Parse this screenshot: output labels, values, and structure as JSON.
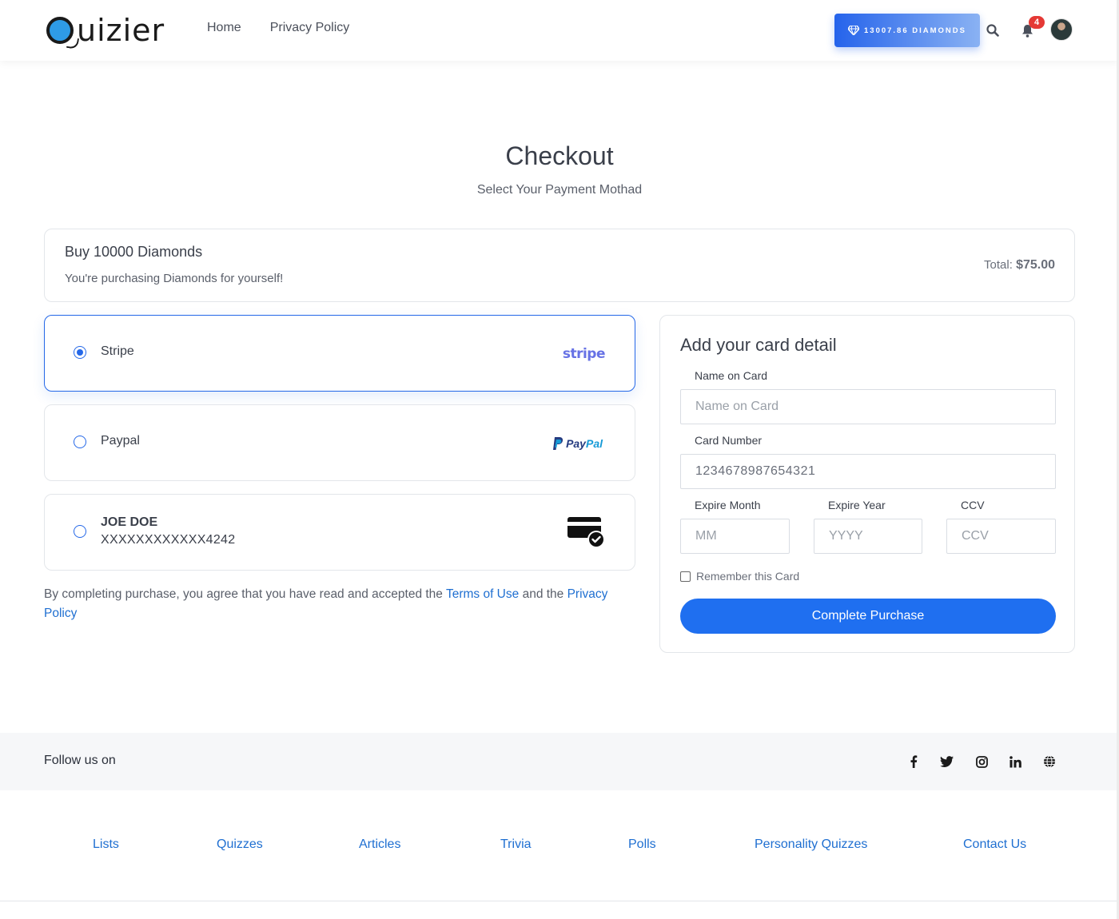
{
  "header": {
    "logo_text": "uizier",
    "nav": [
      "Home",
      "Privacy Policy"
    ],
    "diamonds_label": "13007.86 DIAMONDS",
    "notification_count": "4"
  },
  "page": {
    "title": "Checkout",
    "subtitle": "Select Your Payment Mothad"
  },
  "purchase": {
    "title": "Buy 10000 Diamonds",
    "description": "You're purchasing Diamonds for yourself!",
    "total_label": "Total:",
    "total_value": "$75.00"
  },
  "payment_methods": {
    "stripe_label": "Stripe",
    "stripe_logo": "stripe",
    "paypal_label": "Paypal",
    "paypal_logo_a": "Pay",
    "paypal_logo_b": "Pal",
    "saved_card_name": "JOE DOE",
    "saved_card_number": "XXXXXXXXXXXX4242",
    "selected": "stripe"
  },
  "agreement": {
    "prefix": "By completing purchase, you agree that you have read and accepted the ",
    "terms_link": "Terms of Use",
    "middle": " and the ",
    "privacy_link": "Privacy Policy"
  },
  "card_form": {
    "title": "Add your card detail",
    "name_label": "Name on Card",
    "name_placeholder": "Name on Card",
    "number_label": "Card Number",
    "number_value": "1234678987654321",
    "month_label": "Expire Month",
    "month_placeholder": "MM",
    "year_label": "Expire Year",
    "year_placeholder": "YYYY",
    "ccv_label": "CCV",
    "ccv_placeholder": "CCV",
    "remember_label": "Remember this Card",
    "submit_label": "Complete Purchase"
  },
  "follow": {
    "label": "Follow us on",
    "icons": [
      "facebook-icon",
      "twitter-icon",
      "instagram-icon",
      "linkedin-icon",
      "globe-icon"
    ]
  },
  "footer": {
    "links": [
      "Lists",
      "Quizzes",
      "Articles",
      "Trivia",
      "Polls",
      "Personality Quizzes",
      "Contact Us"
    ]
  },
  "colors": {
    "accent": "#2568e8",
    "link": "#1f6fd1",
    "stripe": "#6772e5",
    "badge": "#e53935"
  }
}
